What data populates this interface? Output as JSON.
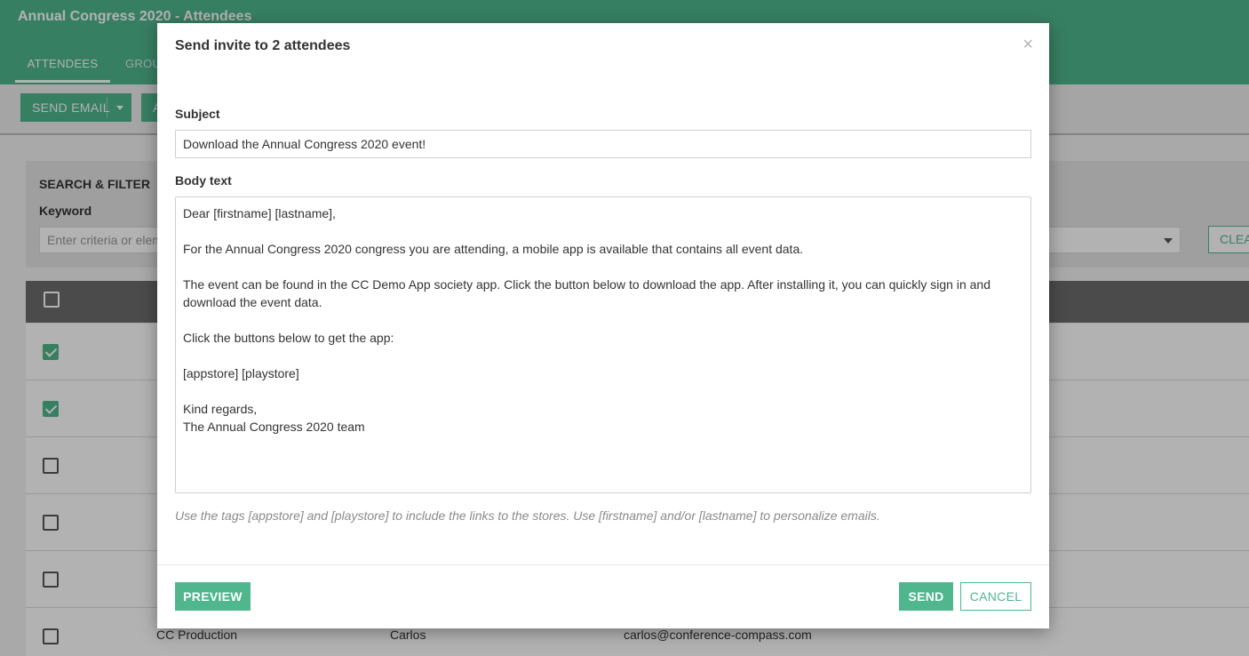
{
  "app": {
    "title": "Annual Congress 2020 - Attendees",
    "tabs": [
      {
        "label": "ATTENDEES",
        "active": true
      },
      {
        "label": "GROU",
        "active": false
      }
    ],
    "toolbar": {
      "send_email_label": "SEND EMAIL",
      "second_button_label": "A"
    },
    "filter": {
      "title": "SEARCH & FILTER",
      "keyword_label": "Keyword",
      "keyword_placeholder": "Enter criteria or elem",
      "clear_label": "CLEA"
    },
    "rows": [
      {
        "checked": true,
        "org": "",
        "first": "",
        "email": ""
      },
      {
        "checked": true,
        "org": "",
        "first": "",
        "email": ""
      },
      {
        "checked": false,
        "org": "",
        "first": "",
        "email": ""
      },
      {
        "checked": false,
        "org": "",
        "first": "",
        "email": ""
      },
      {
        "checked": false,
        "org": "",
        "first": "",
        "email": ""
      },
      {
        "checked": false,
        "org": "CC Production",
        "first": "Carlos",
        "email": "carlos@conference-compass.com"
      }
    ]
  },
  "modal": {
    "title": "Send invite to 2 attendees",
    "close_icon": "×",
    "subject_label": "Subject",
    "subject_value": "Download the Annual Congress 2020 event!",
    "body_label": "Body text",
    "body_value": "Dear [firstname] [lastname],\n\nFor the Annual Congress 2020 congress you are attending, a mobile app is available that contains all event data.\n\nThe event can be found in the CC Demo App society app. Click the button below to download the app. After installing it, you can quickly sign in and download the event data.\n\nClick the buttons below to get the app:\n\n[appstore] [playstore]\n\nKind regards,\nThe Annual Congress 2020 team",
    "help_text": "Use the tags [appstore] and [playstore] to include the links to the stores. Use [firstname] and/or [lastname] to personalize emails.",
    "preview_label": "PREVIEW",
    "send_label": "SEND",
    "cancel_label": "CANCEL"
  },
  "colors": {
    "accent": "#4fb68e",
    "table_header": "#6c6c6c"
  }
}
